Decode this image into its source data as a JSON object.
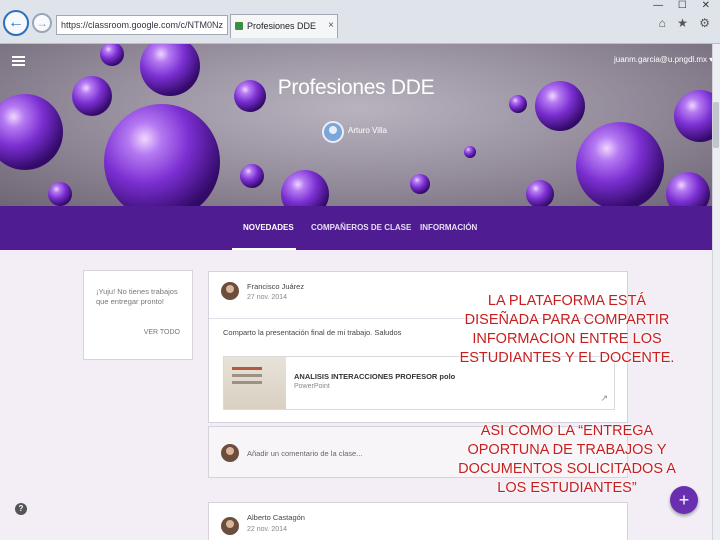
{
  "browser": {
    "address": "https://classroom.google.com/c/NTM0Nz",
    "tab_title": "Profesiones DDE",
    "tab_close": "×",
    "window_controls": "— ☐ ✕",
    "toolbar_icons": "⌂ ★ ⚙",
    "back_glyph": "←",
    "forward_glyph": "→"
  },
  "banner": {
    "title": "Profesiones DDE",
    "teacher": "Arturo Villa",
    "user_email": "juanm.garcia@u.pngdl.mx ▾"
  },
  "nav": {
    "tabs": [
      "NOVEDADES",
      "COMPAÑEROS DE CLASE",
      "INFORMACIÓN"
    ]
  },
  "upcoming": {
    "text": "¡Yuju! No tienes trabajos que entregar pronto!",
    "link": "VER TODO"
  },
  "post": {
    "author": "Francisco Juárez",
    "date": "27 nov. 2014",
    "text": "Comparto la presentación final de mi trabajo. Saludos",
    "attachment_title": "ANALISIS INTERACCIONES PROFESOR polo",
    "attachment_type": "PowerPoint",
    "comment_placeholder": "Añadir un comentario de la clase..."
  },
  "post2": {
    "author": "Alberto Castagón",
    "date": "22 nov. 2014"
  },
  "controls": {
    "help": "?",
    "fab": "+"
  },
  "annotation": {
    "paragraph1": "LA PLATAFORMA ESTÁ DISEÑADA PARA COMPARTIR INFORMACION ENTRE LOS ESTUDIANTES Y EL DOCENTE.",
    "paragraph2": "ASI COMO LA “ENTREGA OPORTUNA DE TRABAJOS Y DOCUMENTOS SOLICITADOS A LOS ESTUDIANTES”"
  },
  "colors": {
    "nav_purple": "#4f1d91",
    "content_bg": "#f3eef6",
    "annotation_red": "#c81e1e",
    "fab_purple": "#6a2fb0"
  }
}
